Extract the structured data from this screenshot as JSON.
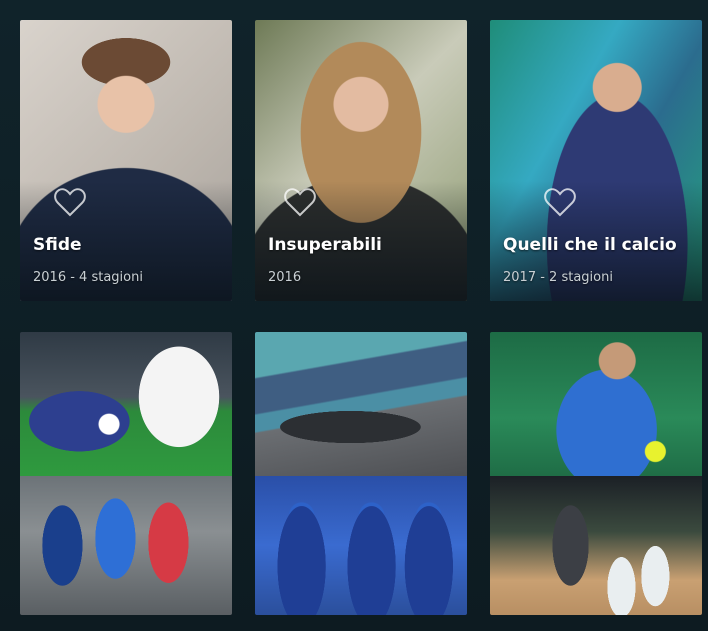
{
  "row1": {
    "cards": [
      {
        "title": "Sfide",
        "subtitle": "2016 - 4 stagioni",
        "icon": "heart-outline-icon"
      },
      {
        "title": "Insuperabili",
        "subtitle": "2016",
        "icon": "heart-outline-icon"
      },
      {
        "title": "Quelli che il calcio",
        "subtitle": "2017 - 2 stagioni",
        "icon": "heart-outline-icon"
      }
    ]
  },
  "row2": {
    "tiles": [
      {
        "top": "soccer-photo",
        "bottom": "cycling-photo"
      },
      {
        "top": "formula1-photo",
        "bottom": "waterpolo-photo"
      },
      {
        "top": "tennis-photo",
        "bottom": "basketball-photo"
      }
    ]
  },
  "colors": {
    "background": "#0e1c22",
    "title": "#ffffff",
    "subtitle": "#c9d0d4"
  }
}
